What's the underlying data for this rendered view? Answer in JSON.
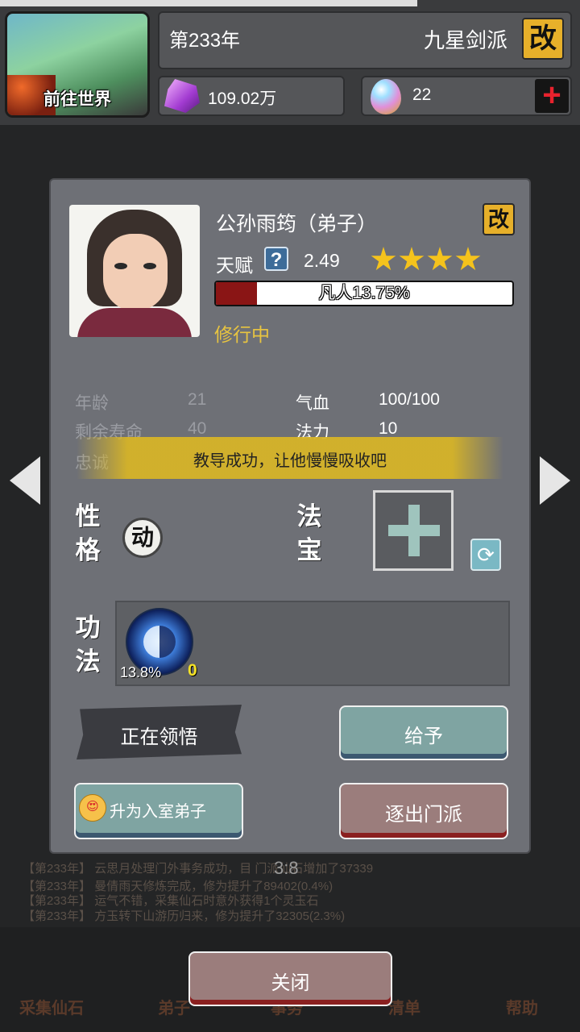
{
  "header": {
    "world_button_label": "前往世界",
    "year": "第233年",
    "sect_name": "九星剑派",
    "rename_label": "改",
    "spirit_stones": "109.02万",
    "eggs": "22",
    "add_label": "+"
  },
  "background": {
    "timer": "3:8",
    "logs": [
      "【第233年】 云思月处理门外事务成功，目 门派仙石增加了37339",
      "【第233年】 曼倩雨天修炼完成，修为提升了89402(0.4%)",
      "【第233年】 运气不错，采集仙石时意外获得1个灵玉石",
      "【第233年】 方玉转下山游历归来，修为提升了32305(2.3%)"
    ],
    "nav": [
      "采集仙石",
      "弟子",
      "事务",
      "清单",
      "帮助"
    ]
  },
  "character": {
    "name": "公孙雨筠（弟子）",
    "rename_label": "改",
    "talent_label": "天赋",
    "talent_help": "?",
    "talent_value": "2.49",
    "stars": 4,
    "realm_text": "凡人13.75%",
    "realm_progress": 0.1375,
    "status": "修行中"
  },
  "stats": {
    "age_label": "年龄",
    "age": "21",
    "lifespan_label": "剩余寿命",
    "lifespan": "40",
    "loyalty_label": "忠诚",
    "hp_label": "气血",
    "hp": "100/100",
    "mana_label": "法力",
    "mana": "10"
  },
  "toast": "教导成功，让他慢慢吸收吧",
  "sections": {
    "personality_title_1": "性",
    "personality_title_2": "格",
    "personality_value": "动",
    "artifact_title_1": "法",
    "artifact_title_2": "宝",
    "skills_title_1": "功",
    "skills_title_2": "法"
  },
  "skill": {
    "percent": "13.8%",
    "level": "0",
    "icon": "yin-yang-icon"
  },
  "buttons": {
    "learning": "正在领悟",
    "give": "给予",
    "promote": "升为入室弟子",
    "promote_icon": "😍",
    "expel": "逐出门派",
    "close": "关闭"
  },
  "colors": {
    "accent_gold": "#e7b02a",
    "status_yellow": "#e8c440",
    "realm_red": "#8a1515",
    "add_red": "#e8222d"
  }
}
